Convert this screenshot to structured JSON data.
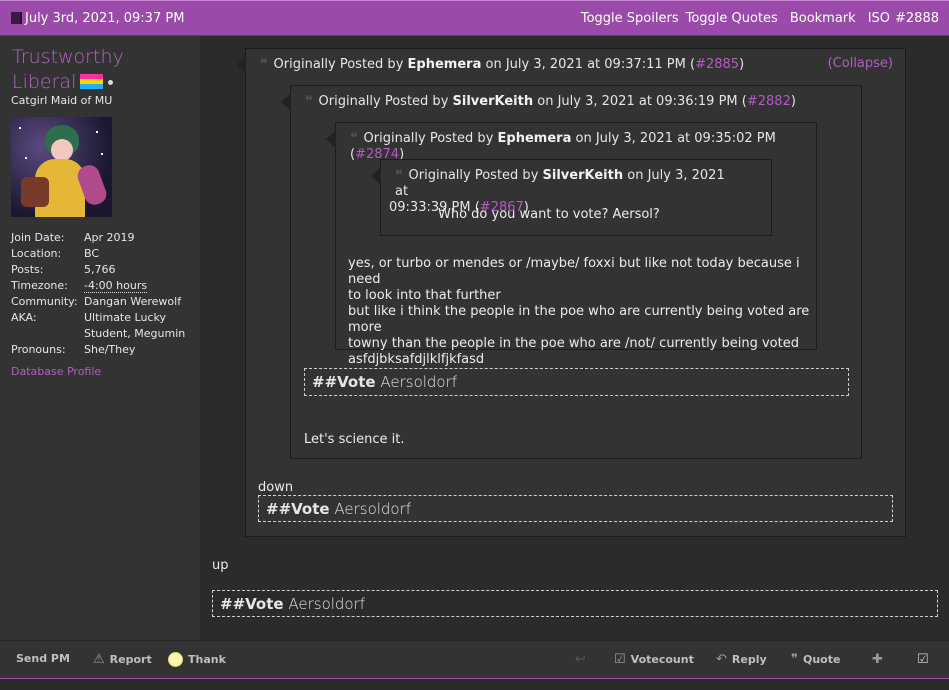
{
  "header": {
    "date": "July 3rd, 2021, 09:37 PM",
    "toggle_spoilers": "Toggle Spoilers",
    "toggle_quotes": "Toggle Quotes",
    "bookmark": "Bookmark",
    "iso": "ISO",
    "post_number": "#2888"
  },
  "user": {
    "name_line1": "Trustworthy",
    "name_line2": "Liberal",
    "title": "Catgirl Maid of MU",
    "info": [
      {
        "k": "Join Date:",
        "v": "Apr 2019"
      },
      {
        "k": "Location:",
        "v": "BC"
      },
      {
        "k": "Posts:",
        "v": "5,766"
      },
      {
        "k": "Timezone:",
        "v": "-4:00 hours"
      },
      {
        "k": "Community:",
        "v": "Dangan Werewolf"
      },
      {
        "k": "AKA:",
        "v": "Ultimate Lucky Student, Megumin"
      },
      {
        "k": "Pronouns:",
        "v": "She/They"
      }
    ],
    "database_profile": "Database Profile"
  },
  "quotes": {
    "prefix": "Originally Posted by",
    "on": "on",
    "q1": {
      "author": "Ephemera",
      "date": "July 3, 2021 at 09:37:11 PM",
      "ref": "#2885",
      "collapse": "(Collapse)"
    },
    "q2": {
      "author": "SilverKeith",
      "date": "July 3, 2021 at 09:36:19 PM",
      "ref": "#2882"
    },
    "q3": {
      "author": "Ephemera",
      "date": "July 3, 2021 at 09:35:02 PM",
      "ref": "#2874"
    },
    "q4": {
      "author": "SilverKeith",
      "date_part1": "July 3, 2021 at",
      "date_part2": "09:33:39 PM",
      "ref": "#2867",
      "body": "Who do you want to vote? Aersol?"
    }
  },
  "q3_body": [
    "yes, or turbo or mendes or /maybe/ foxxi but like not today because i need",
    "to look into that further",
    "but like i think the people in the poe who are currently being voted are more",
    "towny than the people in the poe who are /not/ currently being voted",
    "asfdjbksafdjlklfjkfasd"
  ],
  "vote": {
    "tag": "##Vote",
    "target": "Aersoldorf"
  },
  "q2_after": "Let's science it.",
  "q1_after": "down",
  "post_after": "up",
  "footer": {
    "send_pm": "Send PM",
    "report": "Report",
    "thank": "Thank",
    "votecount": "Votecount",
    "reply": "Reply",
    "quote": "Quote"
  }
}
